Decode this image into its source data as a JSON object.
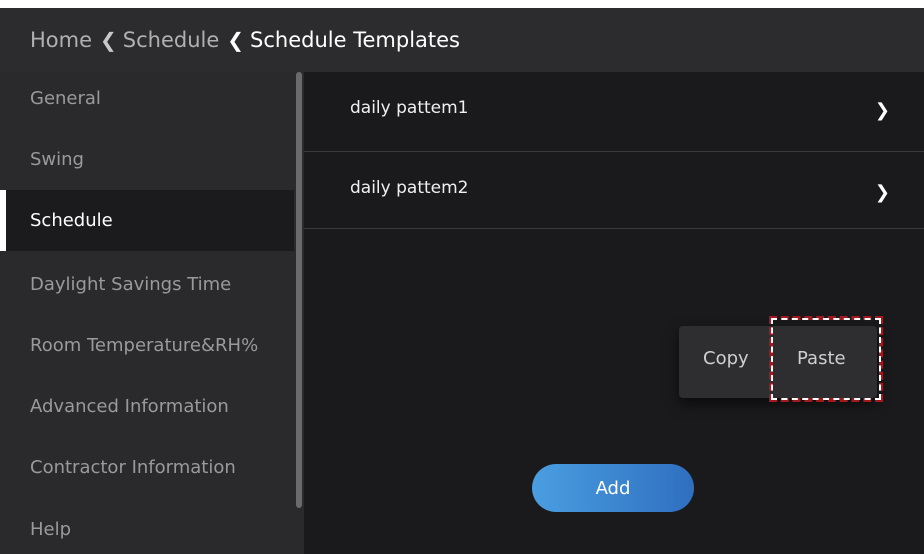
{
  "breadcrumb": {
    "home": "Home",
    "schedule": "Schedule",
    "current": "Schedule Templates"
  },
  "sidebar": {
    "items": [
      {
        "label": "General"
      },
      {
        "label": "Swing"
      },
      {
        "label": "Schedule"
      },
      {
        "label": "Daylight Savings Time"
      },
      {
        "label": "Room Temperature&RH%"
      },
      {
        "label": "Advanced Information"
      },
      {
        "label": "Contractor Information"
      },
      {
        "label": "Help"
      }
    ],
    "selected": "Schedule"
  },
  "main": {
    "patterns": [
      {
        "label": "daily pattem1"
      },
      {
        "label": "daily pattem2"
      }
    ],
    "context_menu": {
      "copy_label": "Copy",
      "paste_label": "Paste"
    },
    "add_label": "Add"
  },
  "colors": {
    "accent_start": "#4a9ee0",
    "accent_end": "#2f6fc0",
    "highlight": "#a01820"
  }
}
